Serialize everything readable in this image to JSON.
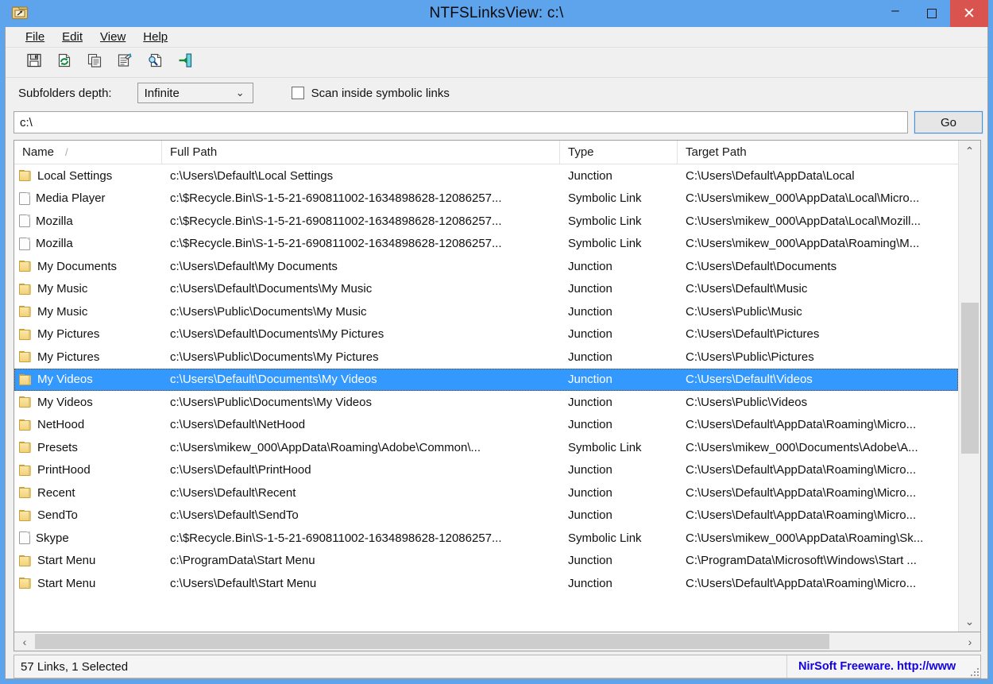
{
  "window": {
    "title": "NTFSLinksView:  c:\\",
    "icon": "folder-link-icon",
    "minimize_label": "–",
    "maximize_label": "",
    "close_label": "✕"
  },
  "menu": [
    {
      "label": "File",
      "accel": "F"
    },
    {
      "label": "Edit",
      "accel": "E"
    },
    {
      "label": "View",
      "accel": "V"
    },
    {
      "label": "Help",
      "accel": "H"
    }
  ],
  "toolbar": [
    {
      "name": "save-icon",
      "title": "Save"
    },
    {
      "name": "refresh-icon",
      "title": "Refresh"
    },
    {
      "name": "copy-icon",
      "title": "Copy"
    },
    {
      "name": "properties-icon",
      "title": "Properties"
    },
    {
      "name": "find-icon",
      "title": "Find"
    },
    {
      "name": "exit-icon",
      "title": "Exit"
    }
  ],
  "options": {
    "depth_label": "Subfolders depth:",
    "depth_value": "Infinite",
    "scan_checkbox_label": "Scan inside symbolic links",
    "scan_checked": false
  },
  "path": {
    "value": "c:\\",
    "go_label": "Go"
  },
  "columns": [
    {
      "key": "name",
      "label": "Name",
      "sort": "/"
    },
    {
      "key": "full_path",
      "label": "Full Path",
      "sort": ""
    },
    {
      "key": "type",
      "label": "Type",
      "sort": ""
    },
    {
      "key": "target_path",
      "label": "Target Path",
      "sort": ""
    }
  ],
  "rows": [
    {
      "icon": "folder",
      "name": "Local Settings",
      "full_path": "c:\\Users\\Default\\Local Settings",
      "type": "Junction",
      "target_path": "C:\\Users\\Default\\AppData\\Local",
      "selected": false
    },
    {
      "icon": "file",
      "name": "Media Player",
      "full_path": "c:\\$Recycle.Bin\\S-1-5-21-690811002-1634898628-12086257...",
      "type": "Symbolic Link",
      "target_path": "C:\\Users\\mikew_000\\AppData\\Local\\Micro...",
      "selected": false
    },
    {
      "icon": "file",
      "name": "Mozilla",
      "full_path": "c:\\$Recycle.Bin\\S-1-5-21-690811002-1634898628-12086257...",
      "type": "Symbolic Link",
      "target_path": "C:\\Users\\mikew_000\\AppData\\Local\\Mozill...",
      "selected": false
    },
    {
      "icon": "file",
      "name": "Mozilla",
      "full_path": "c:\\$Recycle.Bin\\S-1-5-21-690811002-1634898628-12086257...",
      "type": "Symbolic Link",
      "target_path": "C:\\Users\\mikew_000\\AppData\\Roaming\\M...",
      "selected": false
    },
    {
      "icon": "folder",
      "name": "My Documents",
      "full_path": "c:\\Users\\Default\\My Documents",
      "type": "Junction",
      "target_path": "C:\\Users\\Default\\Documents",
      "selected": false
    },
    {
      "icon": "folder",
      "name": "My Music",
      "full_path": "c:\\Users\\Default\\Documents\\My Music",
      "type": "Junction",
      "target_path": "C:\\Users\\Default\\Music",
      "selected": false
    },
    {
      "icon": "folder",
      "name": "My Music",
      "full_path": "c:\\Users\\Public\\Documents\\My Music",
      "type": "Junction",
      "target_path": "C:\\Users\\Public\\Music",
      "selected": false
    },
    {
      "icon": "folder",
      "name": "My Pictures",
      "full_path": "c:\\Users\\Default\\Documents\\My Pictures",
      "type": "Junction",
      "target_path": "C:\\Users\\Default\\Pictures",
      "selected": false
    },
    {
      "icon": "folder",
      "name": "My Pictures",
      "full_path": "c:\\Users\\Public\\Documents\\My Pictures",
      "type": "Junction",
      "target_path": "C:\\Users\\Public\\Pictures",
      "selected": false
    },
    {
      "icon": "folder",
      "name": "My Videos",
      "full_path": "c:\\Users\\Default\\Documents\\My Videos",
      "type": "Junction",
      "target_path": "C:\\Users\\Default\\Videos",
      "selected": true
    },
    {
      "icon": "folder",
      "name": "My Videos",
      "full_path": "c:\\Users\\Public\\Documents\\My Videos",
      "type": "Junction",
      "target_path": "C:\\Users\\Public\\Videos",
      "selected": false
    },
    {
      "icon": "folder",
      "name": "NetHood",
      "full_path": "c:\\Users\\Default\\NetHood",
      "type": "Junction",
      "target_path": "C:\\Users\\Default\\AppData\\Roaming\\Micro...",
      "selected": false
    },
    {
      "icon": "folder",
      "name": "Presets",
      "full_path": "c:\\Users\\mikew_000\\AppData\\Roaming\\Adobe\\Common\\...",
      "type": "Symbolic Link",
      "target_path": "C:\\Users\\mikew_000\\Documents\\Adobe\\A...",
      "selected": false
    },
    {
      "icon": "folder",
      "name": "PrintHood",
      "full_path": "c:\\Users\\Default\\PrintHood",
      "type": "Junction",
      "target_path": "C:\\Users\\Default\\AppData\\Roaming\\Micro...",
      "selected": false
    },
    {
      "icon": "folder",
      "name": "Recent",
      "full_path": "c:\\Users\\Default\\Recent",
      "type": "Junction",
      "target_path": "C:\\Users\\Default\\AppData\\Roaming\\Micro...",
      "selected": false
    },
    {
      "icon": "folder",
      "name": "SendTo",
      "full_path": "c:\\Users\\Default\\SendTo",
      "type": "Junction",
      "target_path": "C:\\Users\\Default\\AppData\\Roaming\\Micro...",
      "selected": false
    },
    {
      "icon": "file",
      "name": "Skype",
      "full_path": "c:\\$Recycle.Bin\\S-1-5-21-690811002-1634898628-12086257...",
      "type": "Symbolic Link",
      "target_path": "C:\\Users\\mikew_000\\AppData\\Roaming\\Sk...",
      "selected": false
    },
    {
      "icon": "folder",
      "name": "Start Menu",
      "full_path": "c:\\ProgramData\\Start Menu",
      "type": "Junction",
      "target_path": "C:\\ProgramData\\Microsoft\\Windows\\Start ...",
      "selected": false
    },
    {
      "icon": "folder",
      "name": "Start Menu",
      "full_path": "c:\\Users\\Default\\Start Menu",
      "type": "Junction",
      "target_path": "C:\\Users\\Default\\AppData\\Roaming\\Micro...",
      "selected": false
    }
  ],
  "scrollbars": {
    "v_up": "⌃",
    "v_down": "⌄",
    "h_left": "‹",
    "h_right": "›"
  },
  "status": {
    "left": "57 Links, 1 Selected",
    "right": "NirSoft Freeware.  http://www"
  },
  "colors": {
    "titlebar": "#5da4ec",
    "close_button": "#d9544f",
    "selection": "#3399ff",
    "link_text": "#1200e8",
    "folder_icon": "#f2d27a"
  }
}
